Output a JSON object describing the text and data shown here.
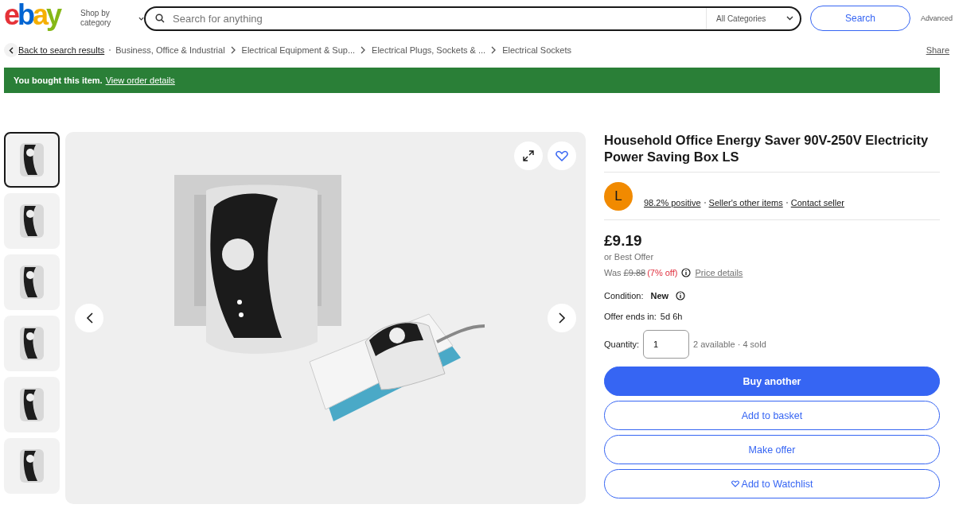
{
  "header": {
    "logo": "ebay",
    "shop_by_category": "Shop by category",
    "search": {
      "placeholder": "Search for anything",
      "category": "All Categories"
    },
    "search_button": "Search",
    "advanced": "Advanced"
  },
  "breadcrumb": {
    "back": "Back to search results",
    "items": [
      "Business, Office & Industrial",
      "Electrical Equipment & Sup...",
      "Electrical Plugs, Sockets & ...",
      "Electrical Sockets"
    ],
    "share": "Share"
  },
  "banner": {
    "message": "You bought this item.",
    "link": "View order details"
  },
  "gallery": {
    "thumbnails": [
      {
        "selected": true
      },
      {
        "selected": false
      },
      {
        "selected": false
      },
      {
        "selected": false
      },
      {
        "selected": false
      },
      {
        "selected": false
      }
    ]
  },
  "product": {
    "title": "Household Office Energy Saver 90V-250V Electricity Power Saving Box LS",
    "seller": {
      "avatar_letter": "L",
      "feedback": "98.2% positive",
      "other_items": "Seller's other items",
      "contact": "Contact seller"
    },
    "price": "£9.19",
    "best_offer": "or Best Offer",
    "was_label": "Was",
    "was_price": "£9.88",
    "discount": "(7% off)",
    "price_details": "Price details",
    "condition_label": "Condition:",
    "condition": "New",
    "offer_label": "Offer ends in:",
    "offer_time": "5d 6h",
    "quantity_label": "Quantity:",
    "quantity": "1",
    "availability": "2 available · 4 sold",
    "buttons": [
      {
        "label": "Buy another",
        "kind": "primary"
      },
      {
        "label": "Add to basket",
        "kind": "secondary"
      },
      {
        "label": "Make offer",
        "kind": "secondary"
      },
      {
        "label": "Add to Watchlist",
        "kind": "watch"
      }
    ]
  }
}
